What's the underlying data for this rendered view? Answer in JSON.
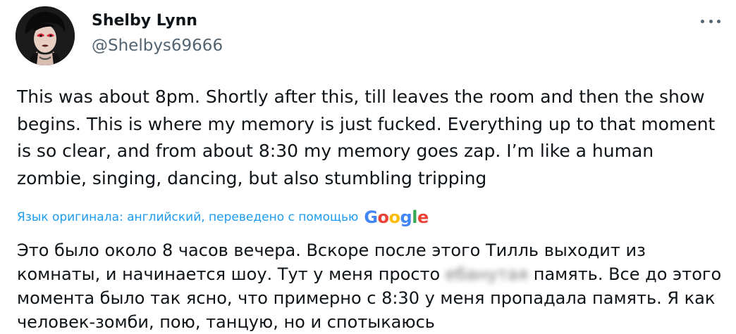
{
  "author": {
    "display_name": "Shelby Lynn",
    "handle": "@Shelbys69666",
    "avatar_icon": "profile-photo"
  },
  "tweet": {
    "text": "This was about 8pm. Shortly after this, till leaves the room and then the show begins. This is where my memory is just fucked. Everything up to that moment is so clear, and from about 8:30 my memory goes zap. I’m like a human zombie, singing, dancing, but also stumbling tripping"
  },
  "translation": {
    "label": "Язык оригинала: английский, переведено с помощью",
    "provider": "Google",
    "text_before_blur": "Это было около 8 часов вечера. Вскоре после этого Тилль выходит из комнаты, и начинается шоу. Тут у меня просто ",
    "blurred_word": "ебанутая",
    "text_after_blur": " память. Все до этого момента было так ясно, что примерно с 8:30 у меня пропадала память. Я как человек-зомби, пою, танцую, но и спотыкаюсь"
  },
  "colors": {
    "text_primary": "#0f1419",
    "text_secondary": "#536471",
    "link": "#1d9bf0"
  },
  "icons": {
    "more": "more-horizontal-icon"
  }
}
